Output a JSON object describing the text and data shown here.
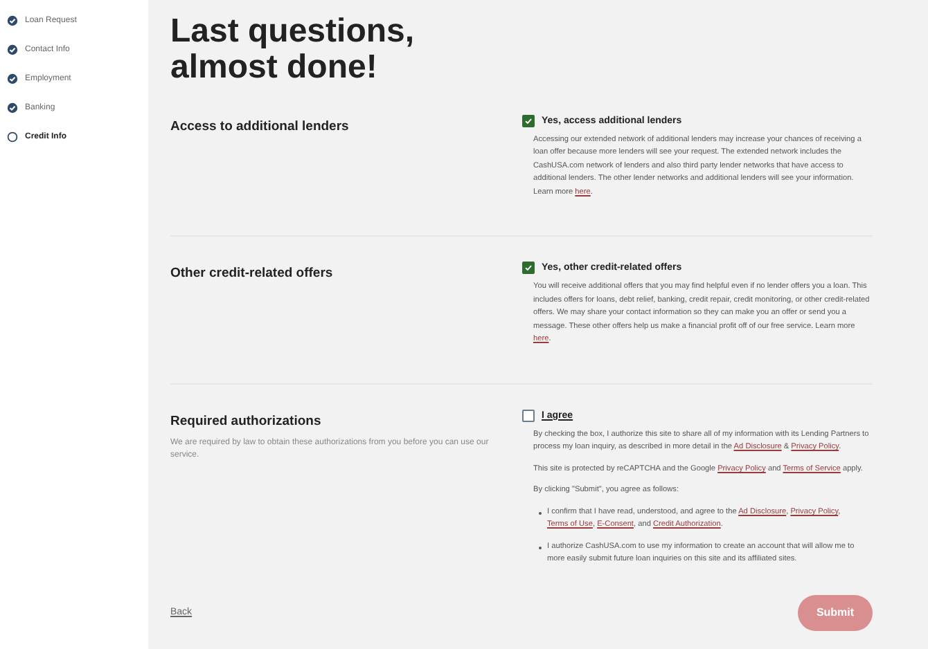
{
  "steps": [
    {
      "label": "Loan Request",
      "completed": true,
      "selected": false
    },
    {
      "label": "Contact Info",
      "completed": true,
      "selected": false
    },
    {
      "label": "Employment",
      "completed": true,
      "selected": false
    },
    {
      "label": "Banking",
      "completed": true,
      "selected": false
    },
    {
      "label": "Credit Info",
      "completed": false,
      "selected": true
    }
  ],
  "title": "Last questions, almost done!",
  "sections": [
    {
      "heading": "Access to additional lenders",
      "checkbox": {
        "label": "Yes, access additional lenders",
        "checked": true
      },
      "paragraphs": [
        [
          {
            "kind": "text",
            "text": "Accessing our extended network of additional lenders may increase your chances of receiving a loan offer because more lenders will see your request. The extended network includes the CashUSA.com network of lenders and also third party lender networks that have access to additional lenders. The other lender networks and additional lenders will see your information. Learn more "
          },
          {
            "kind": "link",
            "text": "here"
          },
          {
            "kind": "text",
            "text": "."
          }
        ]
      ]
    },
    {
      "heading": "Other credit-related offers",
      "checkbox": {
        "label": "Yes, other credit-related offers",
        "checked": true
      },
      "paragraphs": [
        [
          {
            "kind": "text",
            "text": "You will receive additional offers that you may find helpful even if no lender offers you a loan. This includes offers for loans, debt relief, banking, credit repair, credit monitoring, or other credit-related offers. We may share your contact information so they can make you an offer or send you a message. These other offers help us make a financial profit off of our free service. Learn more "
          },
          {
            "kind": "link",
            "text": "here"
          },
          {
            "kind": "text",
            "text": "."
          }
        ]
      ]
    },
    {
      "heading": "Required authorizations",
      "description": "We are required by law to obtain these authorizations from you before you can use our service.",
      "checkbox": {
        "label": "I agree",
        "checked": false
      },
      "paragraphs": [
        [
          {
            "kind": "text",
            "text": "By checking the box, I authorize this site to share all of my information with its Lending Partners to process my loan inquiry, as described in more detail in the "
          },
          {
            "kind": "link",
            "text": "Ad Disclosure"
          },
          {
            "kind": "text",
            "text": " & "
          },
          {
            "kind": "link",
            "text": "Privacy Policy"
          },
          {
            "kind": "text",
            "text": "."
          }
        ],
        [
          {
            "kind": "text",
            "text": "This site is protected by reCAPTCHA and the Google "
          },
          {
            "kind": "link",
            "text": "Privacy Policy"
          },
          {
            "kind": "text",
            "text": " and "
          },
          {
            "kind": "link",
            "text": "Terms of Service"
          },
          {
            "kind": "text",
            "text": " apply."
          }
        ],
        [
          {
            "kind": "text",
            "text": "By clicking \"Submit\", you agree as follows:"
          }
        ]
      ],
      "bullets": [
        [
          {
            "kind": "text",
            "text": "I confirm that I have read, understood, and agree to the "
          },
          {
            "kind": "link",
            "text": "Ad Disclosure"
          },
          {
            "kind": "text",
            "text": ", "
          },
          {
            "kind": "link",
            "text": "Privacy Policy"
          },
          {
            "kind": "text",
            "text": ", "
          },
          {
            "kind": "link",
            "text": "Terms of Use"
          },
          {
            "kind": "text",
            "text": ", "
          },
          {
            "kind": "link",
            "text": "E-Consent"
          },
          {
            "kind": "text",
            "text": ", and "
          },
          {
            "kind": "link",
            "text": "Credit Authorization"
          },
          {
            "kind": "text",
            "text": "."
          }
        ],
        [
          {
            "kind": "text",
            "text": "I authorize CashUSA.com to use my information to create an account that will allow me to more easily submit future loan inquiries on this site and its affiliated sites."
          }
        ]
      ]
    }
  ],
  "back": "Back",
  "submit": "Submit"
}
